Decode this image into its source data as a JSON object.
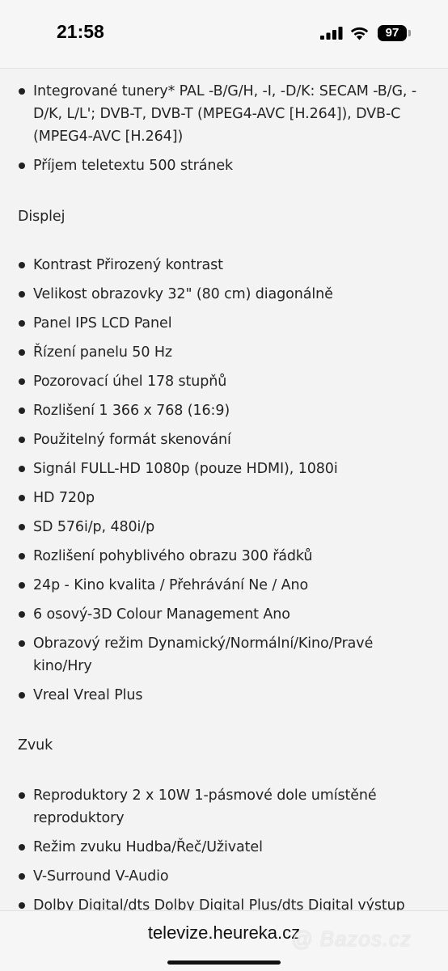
{
  "status_bar": {
    "time": "21:58",
    "battery": "97"
  },
  "section_top": {
    "items": [
      "Integrované tunery* PAL -B/G/H, -I, -D/K: SECAM -B/G, -D/K, L/L'; DVB-T, DVB-T (MPEG4-AVC [H.264]), DVB-C (MPEG4-AVC [H.264])",
      "Příjem teletextu 500 stránek"
    ]
  },
  "section_display": {
    "heading": "Displej",
    "items": [
      "Kontrast Přirozený kontrast",
      "Velikost obrazovky 32\" (80 cm) diagonálně",
      "Panel IPS LCD Panel",
      "Řízení panelu 50 Hz",
      "Pozorovací úhel 178 stupňů",
      "Rozlišení 1 366 x 768 (16:9)",
      "Použitelný formát skenování",
      "Signál FULL-HD 1080p (pouze HDMI), 1080i",
      "HD 720p",
      "SD 576i/p, 480i/p",
      "Rozlišení pohyblivého obrazu 300 řádků",
      "24p - Kino kvalita / Přehrávání Ne / Ano",
      "6 osový-3D Colour Management Ano",
      "Obrazový režim Dynamický/Normální/Kino/Pravé kino/Hry",
      "Vreal Vreal Plus"
    ]
  },
  "section_sound": {
    "heading": "Zvuk",
    "items": [
      "Reproduktory 2 x 10W 1-pásmové dole umístěné reproduktory",
      "Režim zvuku Hudba/Řeč/Uživatel",
      "V-Surround V-Audio",
      "Dolby Digital/dts Dolby Digital Plus/dts Digital výstup"
    ]
  },
  "browser": {
    "url": "televize.heureka.cz"
  },
  "watermark": "@ Bazos.cz"
}
